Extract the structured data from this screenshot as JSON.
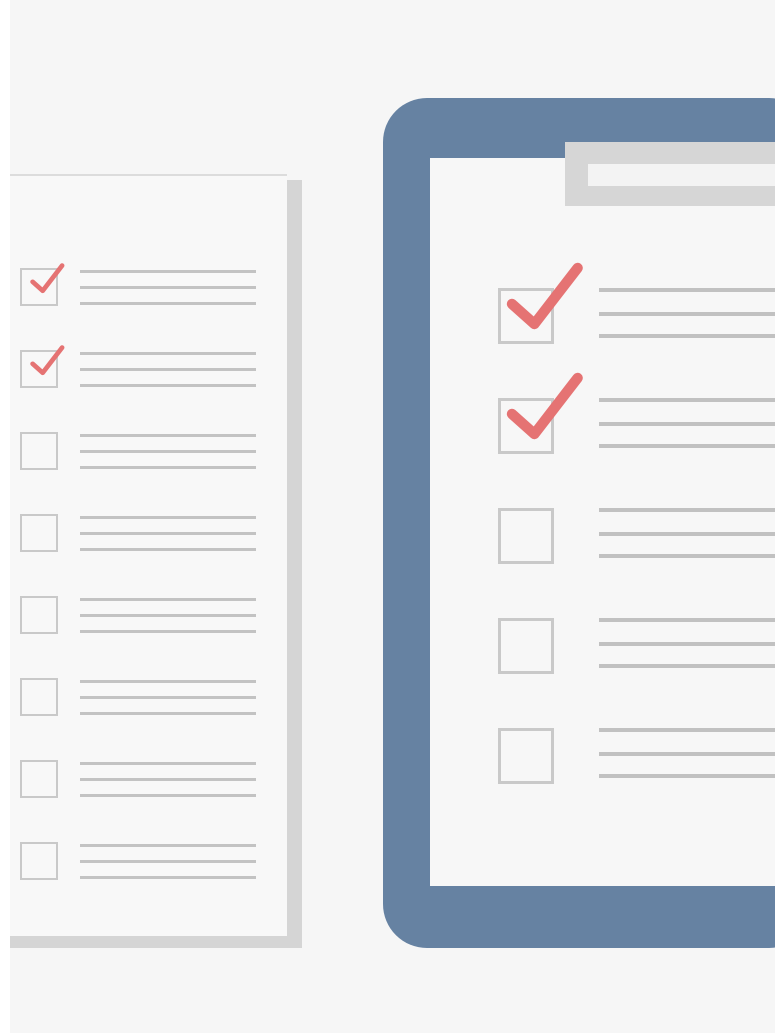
{
  "colors": {
    "background": "#f6f6f6",
    "clipboard": "#6682a2",
    "checkmark": "#e57373",
    "box_border": "#c9c9c9",
    "text_line": "#c3c3c3",
    "sheet_shadow": "#d5d5d5"
  },
  "left_checklist": {
    "items": [
      {
        "checked": true
      },
      {
        "checked": true
      },
      {
        "checked": false
      },
      {
        "checked": false
      },
      {
        "checked": false
      },
      {
        "checked": false
      },
      {
        "checked": false
      },
      {
        "checked": false
      }
    ]
  },
  "clipboard_checklist": {
    "items": [
      {
        "checked": true
      },
      {
        "checked": true
      },
      {
        "checked": false
      },
      {
        "checked": false
      },
      {
        "checked": false
      }
    ]
  },
  "icons": [
    "checkmark-icon",
    "checkbox-icon",
    "clipboard-icon",
    "clipboard-clip-icon"
  ]
}
